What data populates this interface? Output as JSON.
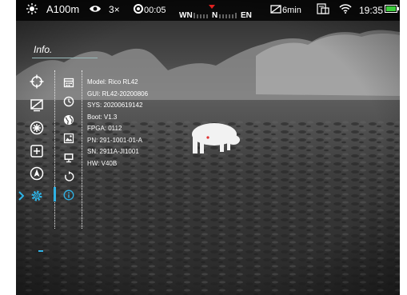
{
  "status_bar": {
    "icons": [
      "brightness-icon",
      "eye-icon",
      "record-timer-icon",
      "compass-icon",
      "battery-saver-icon",
      "picture-in-picture-icon",
      "wifi-icon",
      "battery-icon"
    ],
    "mode": "A100m",
    "zoom": "3×",
    "record_time": "00:05",
    "compass": {
      "left": "WN",
      "center": "N",
      "right": "EN"
    },
    "auto_off": "6min",
    "time": "19:35",
    "battery_color": "#3ccb3c"
  },
  "menu": {
    "title": "Info.",
    "main_items": [
      "crosshair-icon",
      "display-off-icon",
      "color-palette-icon",
      "zero-icon",
      "compass-nav-icon",
      "settings-icon"
    ],
    "sub_items": [
      "calendar-icon",
      "clock-icon",
      "globe-icon",
      "image-icon",
      "monitor-icon",
      "restore-icon",
      "info-icon"
    ],
    "selected_main": "settings-icon",
    "selected_sub": "info-icon",
    "accent": "#2fb3e6"
  },
  "device_info": [
    "Model: Rico RL42",
    "GUI: RL42-20200806",
    "SYS: 20200619142",
    "Boot: V1.3",
    "FPGA: 0112",
    "PN: 291-1001-01-A",
    "SN: 2911A-JI1001",
    "HW: V40B"
  ]
}
